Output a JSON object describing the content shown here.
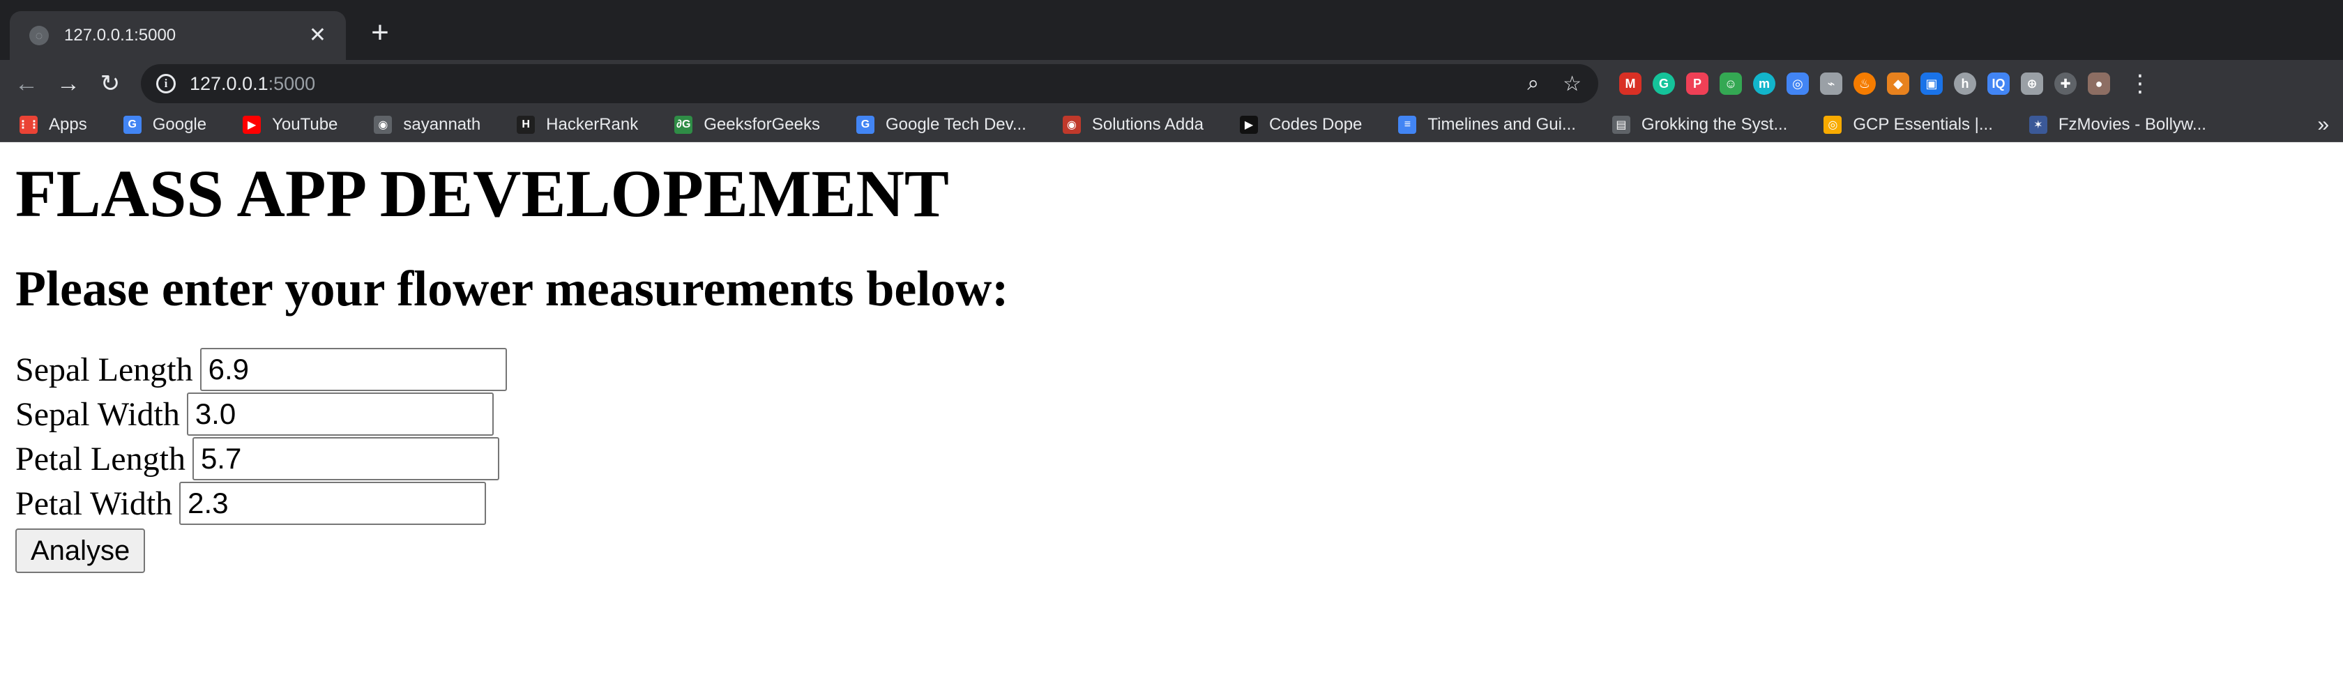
{
  "browser": {
    "tab_title": "127.0.0.1:5000",
    "tab_close": "✕",
    "new_tab": "+",
    "nav": {
      "back": "←",
      "forward": "→",
      "reload": "↻"
    },
    "url_host": "127.0.0.1",
    "url_port": ":5000",
    "info_glyph": "i",
    "zoom_icon": "⌕",
    "star_icon": "☆",
    "menu_icon": "⋮",
    "extensions": [
      {
        "name": "gmail-extension-icon",
        "glyph": "M",
        "color": "#d93025"
      },
      {
        "name": "grammarly-extension-icon",
        "glyph": "G",
        "color": "#15c39a"
      },
      {
        "name": "pocket-extension-icon",
        "glyph": "P",
        "color": "#ef4056"
      },
      {
        "name": "green-extension-icon",
        "glyph": "☺",
        "color": "#34a853"
      },
      {
        "name": "teal-extension-icon",
        "glyph": "m",
        "color": "#12b5cb"
      },
      {
        "name": "owl-extension-icon",
        "glyph": "◎",
        "color": "#4285f4"
      },
      {
        "name": "link-extension-icon",
        "glyph": "⌁",
        "color": "#9aa0a6"
      },
      {
        "name": "fire-extension-icon",
        "glyph": "♨",
        "color": "#f57c00"
      },
      {
        "name": "metamask-extension-icon",
        "glyph": "◆",
        "color": "#e8821e"
      },
      {
        "name": "blue-square-extension-icon",
        "glyph": "▣",
        "color": "#1a73e8"
      },
      {
        "name": "gray-extension-icon",
        "glyph": "h",
        "color": "#9aa0a6"
      },
      {
        "name": "iq-extension-icon",
        "glyph": "IQ",
        "color": "#4285f4"
      },
      {
        "name": "globe-extension-icon",
        "glyph": "⊕",
        "color": "#9aa0a6"
      },
      {
        "name": "puzzle-extension-icon",
        "glyph": "✚",
        "color": "#5f6368"
      },
      {
        "name": "profile-avatar-icon",
        "glyph": "●",
        "color": "#8d6e63"
      }
    ],
    "bookmarks": [
      {
        "label": "Apps",
        "icon": "apps-grid-icon",
        "glyph": "⋮⋮",
        "color": "#ea4335"
      },
      {
        "label": "Google",
        "icon": "google-icon",
        "glyph": "G",
        "color": "#4285f4"
      },
      {
        "label": "YouTube",
        "icon": "youtube-icon",
        "glyph": "▶",
        "color": "#ff0000"
      },
      {
        "label": "sayannath",
        "icon": "github-icon",
        "glyph": "◉",
        "color": "#5f6368"
      },
      {
        "label": "HackerRank",
        "icon": "hackerrank-icon",
        "glyph": "H",
        "color": "#1f1f1f"
      },
      {
        "label": "GeeksforGeeks",
        "icon": "geeksforgeeks-icon",
        "glyph": "∂G",
        "color": "#2f8d46"
      },
      {
        "label": "Google Tech Dev...",
        "icon": "google-icon",
        "glyph": "G",
        "color": "#4285f4"
      },
      {
        "label": "Solutions Adda",
        "icon": "solutions-adda-icon",
        "glyph": "◉",
        "color": "#c0392b"
      },
      {
        "label": "Codes Dope",
        "icon": "codes-dope-icon",
        "glyph": "▶",
        "color": "#111111"
      },
      {
        "label": "Timelines and Gui...",
        "icon": "google-docs-icon",
        "glyph": "≡",
        "color": "#4285f4"
      },
      {
        "label": "Grokking the Syst...",
        "icon": "terminal-icon",
        "glyph": "▤",
        "color": "#5f6368"
      },
      {
        "label": "GCP Essentials |...",
        "icon": "gcp-icon",
        "glyph": "◎",
        "color": "#f9ab00"
      },
      {
        "label": "FzMovies - Bollyw...",
        "icon": "fzmovies-icon",
        "glyph": "✶",
        "color": "#3b5998"
      }
    ],
    "bookmarks_more": "»"
  },
  "page": {
    "title": "FLASS APP DEVELOPEMENT",
    "subtitle": "Please enter your flower measurements below:",
    "fields": [
      {
        "label": "Sepal Length",
        "value": "6.9",
        "name": "sepal-length-input"
      },
      {
        "label": "Sepal Width",
        "value": "3.0",
        "name": "sepal-width-input"
      },
      {
        "label": "Petal Length",
        "value": "5.7",
        "name": "petal-length-input"
      },
      {
        "label": "Petal Width",
        "value": "2.3",
        "name": "petal-width-input"
      }
    ],
    "submit_label": "Analyse"
  }
}
